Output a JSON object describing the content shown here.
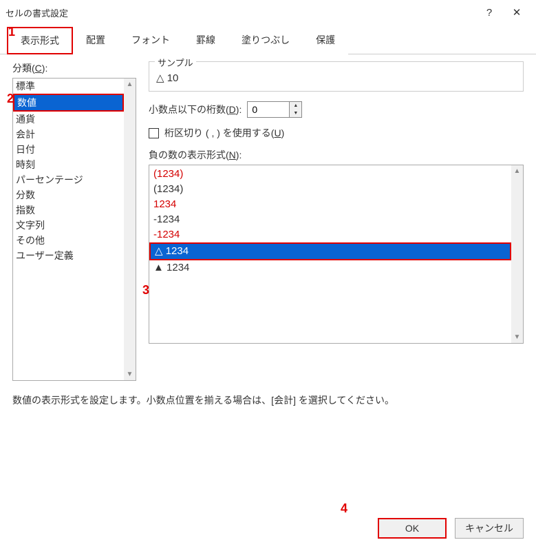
{
  "window": {
    "title": "セルの書式設定",
    "help": "?",
    "close": "✕"
  },
  "annotations": {
    "a1": "1",
    "a2": "2",
    "a3": "3",
    "a4": "4"
  },
  "tabs": {
    "items": [
      {
        "label": "表示形式",
        "active": true
      },
      {
        "label": "配置",
        "active": false
      },
      {
        "label": "フォント",
        "active": false
      },
      {
        "label": "罫線",
        "active": false
      },
      {
        "label": "塗りつぶし",
        "active": false
      },
      {
        "label": "保護",
        "active": false
      }
    ]
  },
  "category": {
    "label_prefix": "分類(",
    "label_key": "C",
    "label_suffix": "):",
    "items": [
      {
        "label": "標準",
        "selected": false
      },
      {
        "label": "数値",
        "selected": true
      },
      {
        "label": "通貨",
        "selected": false
      },
      {
        "label": "会計",
        "selected": false
      },
      {
        "label": "日付",
        "selected": false
      },
      {
        "label": "時刻",
        "selected": false
      },
      {
        "label": "パーセンテージ",
        "selected": false
      },
      {
        "label": "分数",
        "selected": false
      },
      {
        "label": "指数",
        "selected": false
      },
      {
        "label": "文字列",
        "selected": false
      },
      {
        "label": "その他",
        "selected": false
      },
      {
        "label": "ユーザー定義",
        "selected": false
      }
    ]
  },
  "sample": {
    "legend": "サンプル",
    "value": "△ 10"
  },
  "decimal": {
    "label_prefix": "小数点以下の桁数(",
    "label_key": "D",
    "label_suffix": "):",
    "value": "0"
  },
  "thousands": {
    "label_prefix": "桁区切り ( , ) を使用する(",
    "label_key": "U",
    "label_suffix": ")",
    "checked": false
  },
  "negative": {
    "label_prefix": "負の数の表示形式(",
    "label_key": "N",
    "label_suffix": "):",
    "items": [
      {
        "label": "(1234)",
        "color": "red",
        "selected": false
      },
      {
        "label": "(1234)",
        "color": "black",
        "selected": false
      },
      {
        "label": "1234",
        "color": "red",
        "selected": false
      },
      {
        "label": "-1234",
        "color": "black",
        "selected": false
      },
      {
        "label": "-1234",
        "color": "red",
        "selected": false
      },
      {
        "label": "△ 1234",
        "color": "black",
        "selected": true
      },
      {
        "label": "▲ 1234",
        "color": "black",
        "selected": false
      }
    ]
  },
  "help_text": "数値の表示形式を設定します。小数点位置を揃える場合は、[会計] を選択してください。",
  "buttons": {
    "ok": "OK",
    "cancel": "キャンセル"
  }
}
